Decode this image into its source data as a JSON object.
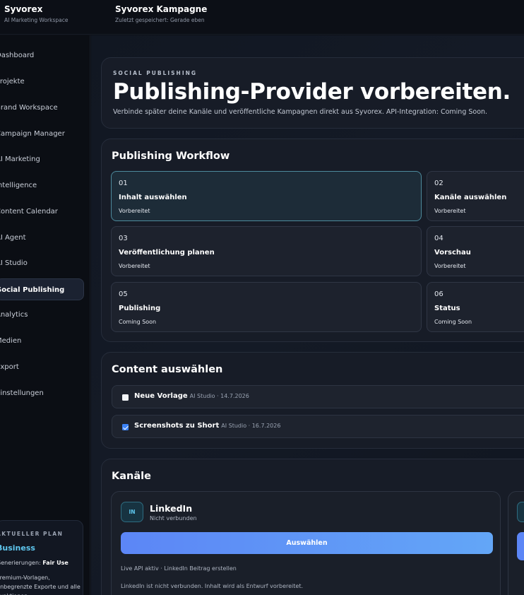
{
  "topbar": {
    "brand": "Syvorex",
    "brand_sub": "AI Marketing Workspace",
    "project": "Syvorex Kampagne",
    "project_sub": "Zuletzt gespeichert: Gerade eben"
  },
  "sidebar": {
    "items": [
      {
        "label": "Dashboard",
        "icon": "dashboard-icon"
      },
      {
        "label": "Projekte",
        "icon": "folder-icon"
      },
      {
        "label": "Brand Workspace",
        "icon": "brand-icon"
      },
      {
        "label": "Campaign Manager",
        "icon": "campaign-icon"
      },
      {
        "label": "AI Marketing",
        "icon": "sparkle-icon"
      },
      {
        "label": "Intelligence",
        "icon": "brain-icon"
      },
      {
        "label": "Content Calendar",
        "icon": "calendar-icon"
      },
      {
        "label": "AI Agent",
        "icon": "robot-icon"
      },
      {
        "label": "AI Studio",
        "icon": "studio-icon"
      },
      {
        "label": "Social Publishing",
        "icon": "share-icon",
        "active": true
      },
      {
        "label": "Analytics",
        "icon": "chart-icon"
      },
      {
        "label": "Medien",
        "icon": "media-icon"
      },
      {
        "label": "Export",
        "icon": "export-icon"
      },
      {
        "label": "Einstellungen",
        "icon": "gear-icon"
      }
    ],
    "plan": {
      "label": "AKTUELLER PLAN",
      "name": "Business",
      "generations_label": "Generierungen:",
      "generations_value": "Fair Use",
      "features": "Premium-Vorlagen, unbegrenzte Exporte und alle Funktionen"
    }
  },
  "hero": {
    "kicker": "SOCIAL PUBLISHING",
    "title": "Publishing-Provider vorbereiten.",
    "subtitle": "Verbinde später deine Kanäle und veröffentliche Kampagnen direkt aus Syvorex. API-Integration: Coming Soon."
  },
  "workflow": {
    "title": "Publishing Workflow",
    "steps": [
      {
        "num": "01",
        "title": "Inhalt auswählen",
        "status": "Vorbereitet",
        "active": true
      },
      {
        "num": "02",
        "title": "Kanäle auswählen",
        "status": "Vorbereitet"
      },
      {
        "num": "03",
        "title": "Veröffentlichung planen",
        "status": "Vorbereitet"
      },
      {
        "num": "04",
        "title": "Vorschau",
        "status": "Vorbereitet"
      },
      {
        "num": "05",
        "title": "Publishing",
        "status": "Coming Soon"
      },
      {
        "num": "06",
        "title": "Status",
        "status": "Coming Soon"
      }
    ]
  },
  "content": {
    "title": "Content auswählen",
    "items": [
      {
        "title": "Neue Vorlage",
        "meta": "AI Studio · 14.7.2026",
        "checked": false
      },
      {
        "title": "Screenshots zu Short",
        "meta": "AI Studio · 16.7.2026",
        "checked": true
      }
    ]
  },
  "channels": {
    "title": "Kanäle",
    "cards": [
      {
        "badge": "IN",
        "name": "LinkedIn",
        "status": "Nicht verbunden",
        "button": "Auswählen",
        "info": "Live API aktiv · LinkedIn Beitrag erstellen",
        "note": "LinkedIn ist nicht verbunden. Inhalt wird als Entwurf vorbereitet."
      }
    ]
  },
  "colors": {
    "accent": "#5fc8f0",
    "button_start": "#5c86f6",
    "button_end": "#63a6f7",
    "background": "#0d1017"
  }
}
